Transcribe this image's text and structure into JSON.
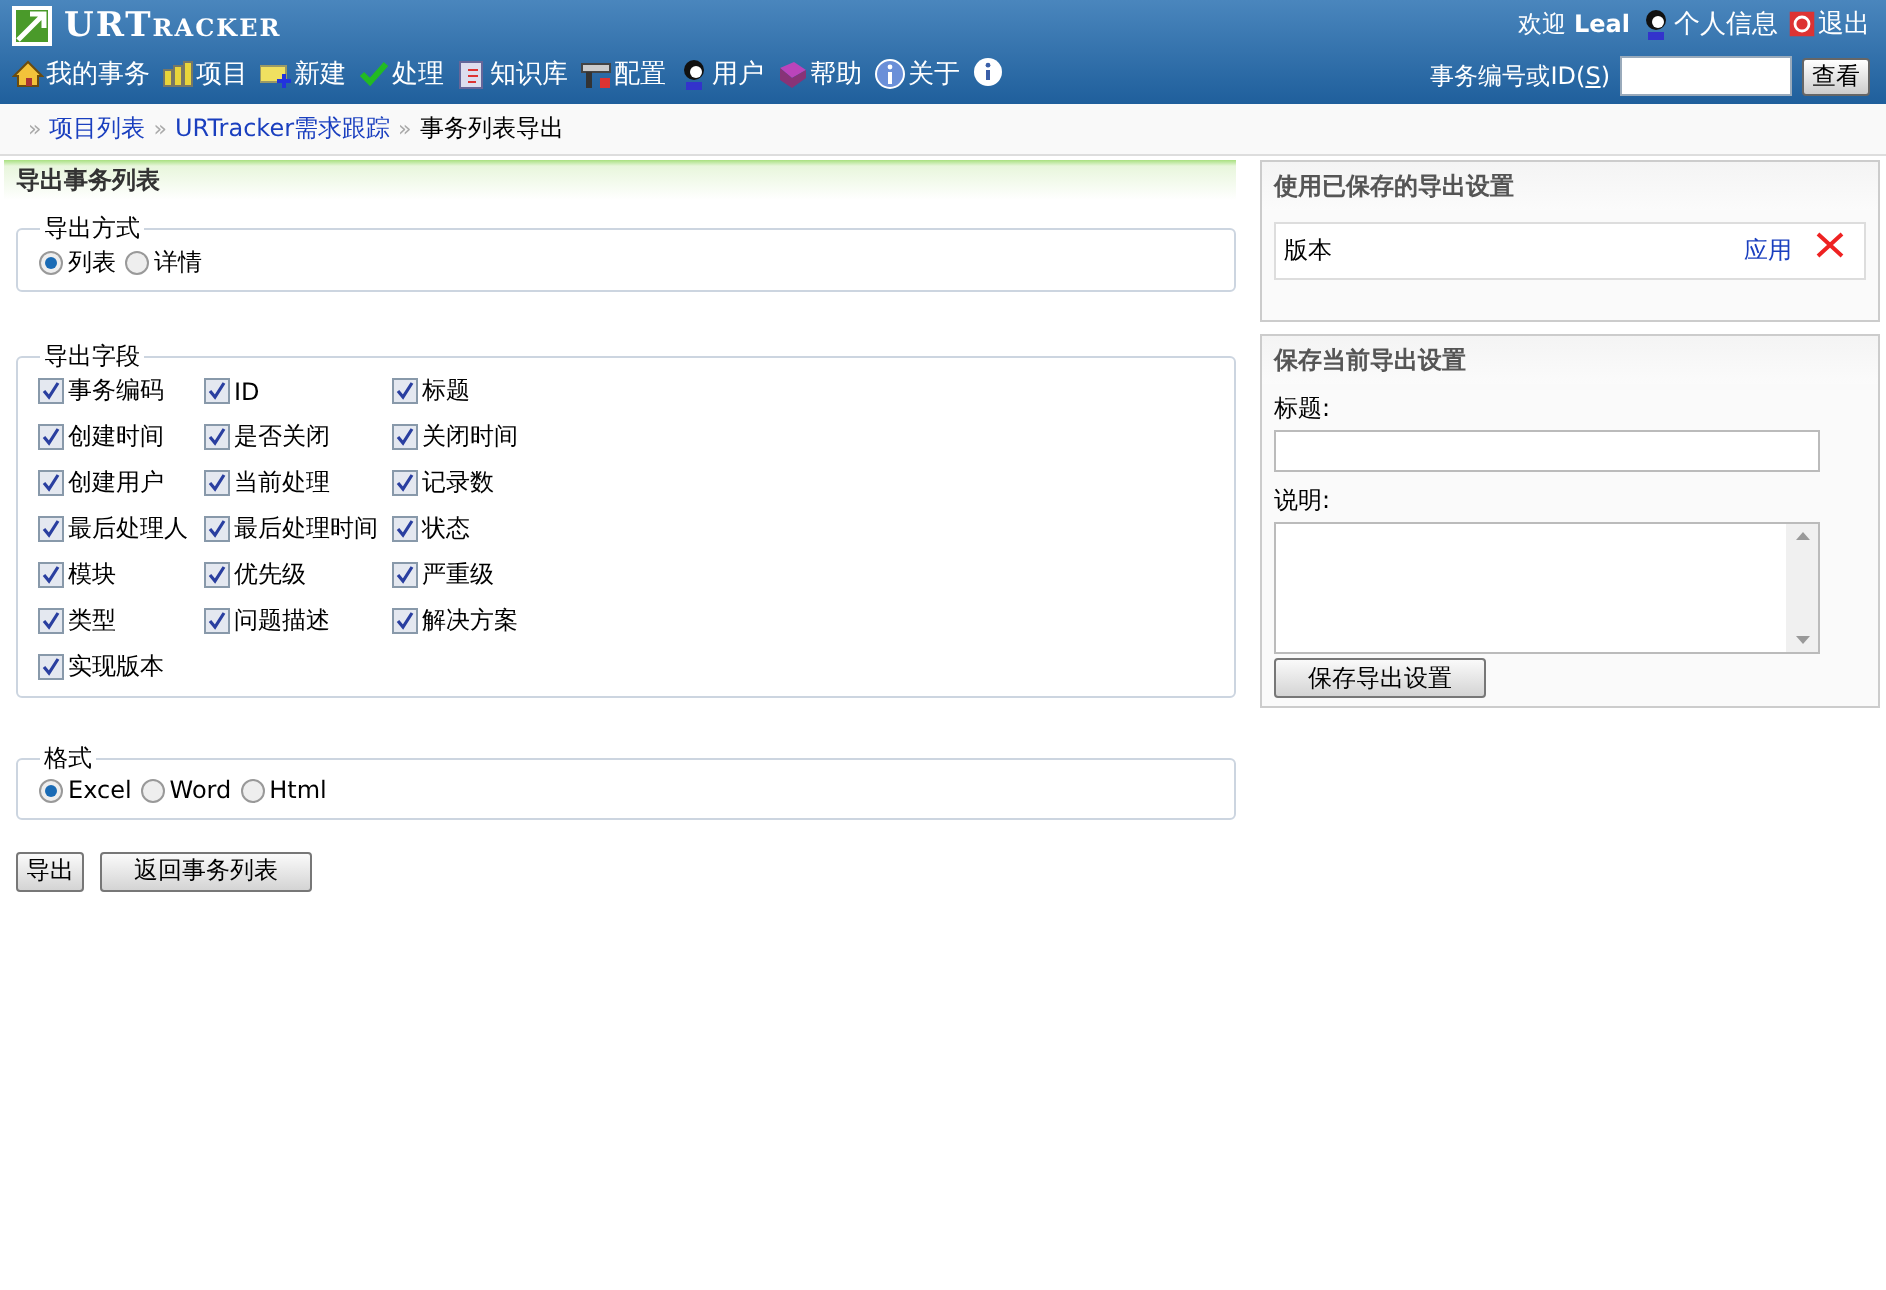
{
  "header": {
    "logo": "URTracker",
    "welcome": "欢迎",
    "user": "Leal",
    "user_links": [
      "个人信息",
      "退出"
    ],
    "nav": [
      "我的事务",
      "项目",
      "新建",
      "处理",
      "知识库",
      "配置",
      "用户",
      "帮助",
      "关于"
    ],
    "search": {
      "label": "事务编号或ID(",
      "accesskey": "S",
      "label_end": ")",
      "button": "查看"
    }
  },
  "breadcrumb": {
    "separator": "»",
    "links": [
      "项目列表",
      "URTracker需求跟踪"
    ],
    "current": "事务列表导出"
  },
  "export": {
    "title": "导出事务列表",
    "mode": {
      "legend": "导出方式",
      "options": [
        {
          "label": "列表",
          "selected": true
        },
        {
          "label": "详情",
          "selected": false
        }
      ]
    },
    "fields": {
      "legend": "导出字段",
      "items": [
        {
          "label": "事务编码",
          "checked": true
        },
        {
          "label": "ID",
          "checked": true
        },
        {
          "label": "标题",
          "checked": true
        },
        {
          "label": "创建时间",
          "checked": true
        },
        {
          "label": "是否关闭",
          "checked": true
        },
        {
          "label": "关闭时间",
          "checked": true
        },
        {
          "label": "创建用户",
          "checked": true
        },
        {
          "label": "当前处理",
          "checked": true
        },
        {
          "label": "记录数",
          "checked": true
        },
        {
          "label": "最后处理人",
          "checked": true
        },
        {
          "label": "最后处理时间",
          "checked": true
        },
        {
          "label": "状态",
          "checked": true
        },
        {
          "label": "模块",
          "checked": true
        },
        {
          "label": "优先级",
          "checked": true
        },
        {
          "label": "严重级",
          "checked": true
        },
        {
          "label": "类型",
          "checked": true
        },
        {
          "label": "问题描述",
          "checked": true
        },
        {
          "label": "解决方案",
          "checked": true
        },
        {
          "label": "实现版本",
          "checked": true
        }
      ]
    },
    "format": {
      "legend": "格式",
      "options": [
        {
          "label": "Excel",
          "selected": true
        },
        {
          "label": "Word",
          "selected": false
        },
        {
          "label": "Html",
          "selected": false
        }
      ]
    },
    "buttons": [
      "导出",
      "返回事务列表"
    ]
  },
  "saved": {
    "title": "使用已保存的导出设置",
    "rows": [
      {
        "name": "版本",
        "action": "应用"
      }
    ]
  },
  "save_form": {
    "title": "保存当前导出设置",
    "title_label": "标题:",
    "desc_label": "说明:",
    "button": "保存导出设置"
  }
}
